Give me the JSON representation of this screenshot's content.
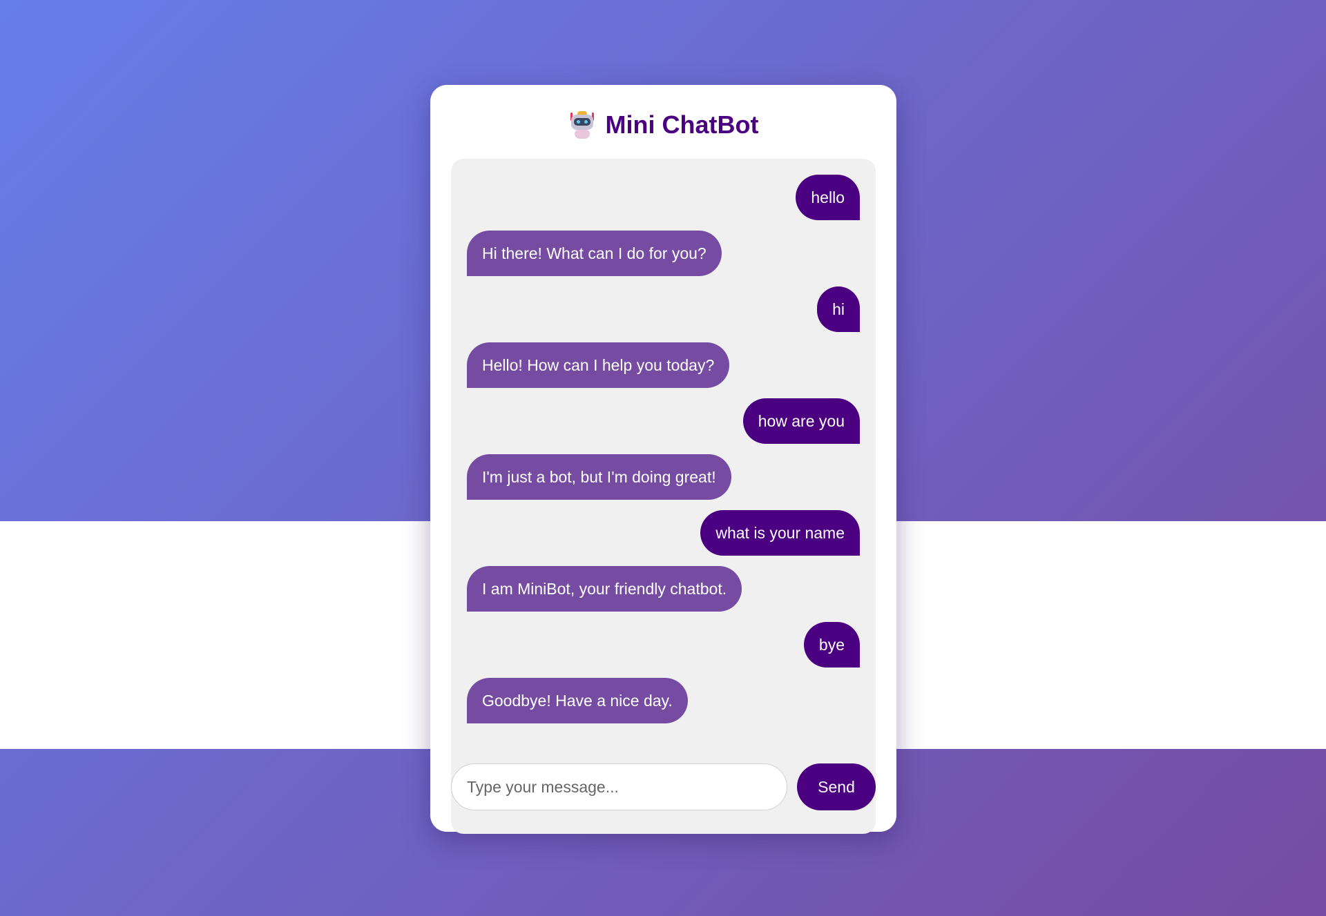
{
  "app": {
    "title": "Mini ChatBot",
    "icon": "robot-icon"
  },
  "colors": {
    "background_gradient_start": "#667eea",
    "background_gradient_end": "#764ba2",
    "user_bubble": "#4b0082",
    "bot_bubble": "#764ba2",
    "title": "#4b0082",
    "chat_area": "#f0f0f1"
  },
  "messages": [
    {
      "sender": "user",
      "text": "hello"
    },
    {
      "sender": "bot",
      "text": "Hi there! What can I do for you?"
    },
    {
      "sender": "user",
      "text": "hi"
    },
    {
      "sender": "bot",
      "text": "Hello! How can I help you today?"
    },
    {
      "sender": "user",
      "text": "how are you"
    },
    {
      "sender": "bot",
      "text": "I'm just a bot, but I'm doing great!"
    },
    {
      "sender": "user",
      "text": "what is your name"
    },
    {
      "sender": "bot",
      "text": "I am MiniBot, your friendly chatbot."
    },
    {
      "sender": "user",
      "text": "bye"
    },
    {
      "sender": "bot",
      "text": "Goodbye! Have a nice day."
    }
  ],
  "composer": {
    "placeholder": "Type your message...",
    "value": "",
    "send_label": "Send"
  }
}
